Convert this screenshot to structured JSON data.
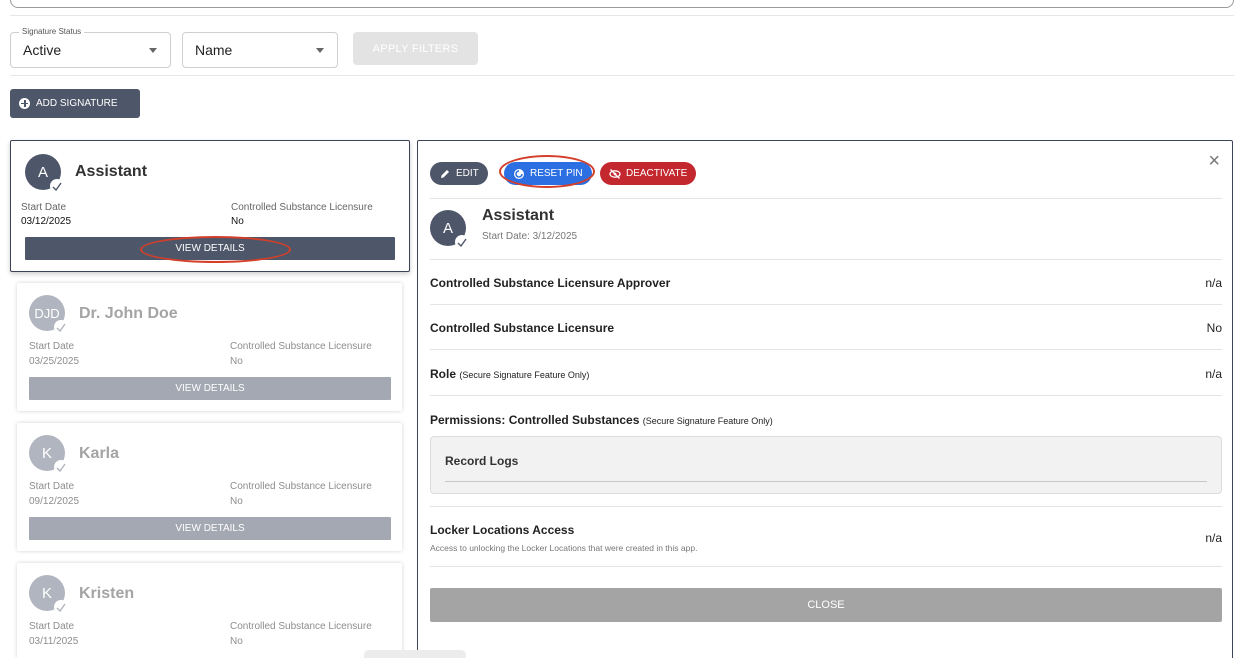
{
  "filters": {
    "status_legend": "Signature Status",
    "status_value": "Active",
    "sort_value": "Name",
    "apply_label": "APPLY FILTERS"
  },
  "add_signature_label": "ADD SIGNATURE",
  "cards": [
    {
      "initials": "A",
      "name": "Assistant",
      "start_label": "Start Date",
      "start_value": "03/12/2025",
      "csl_label": "Controlled Substance Licensure",
      "csl_value": "No",
      "view_label": "VIEW DETAILS"
    },
    {
      "initials": "DJD",
      "name": "Dr. John Doe",
      "start_label": "Start Date",
      "start_value": "03/25/2025",
      "csl_label": "Controlled Substance Licensure",
      "csl_value": "No",
      "view_label": "VIEW DETAILS"
    },
    {
      "initials": "K",
      "name": "Karla",
      "start_label": "Start Date",
      "start_value": "09/12/2025",
      "csl_label": "Controlled Substance Licensure",
      "csl_value": "No",
      "view_label": "VIEW DETAILS"
    },
    {
      "initials": "K",
      "name": "Kristen",
      "start_label": "Start Date",
      "start_value": "03/11/2025",
      "csl_label": "Controlled Substance Licensure",
      "csl_value": "No",
      "view_label": "VIEW DETAILS"
    }
  ],
  "detail": {
    "edit_label": "EDIT",
    "reset_pin_label": "RESET PIN",
    "deactivate_label": "DEACTIVATE",
    "close_x": "×",
    "initials": "A",
    "name": "Assistant",
    "start": "Start Date: 3/12/2025",
    "rows": [
      {
        "label": "Controlled Substance Licensure Approver",
        "note": "",
        "value": "n/a"
      },
      {
        "label": "Controlled Substance Licensure",
        "note": "",
        "value": "No"
      },
      {
        "label": "Role",
        "note": "(Secure Signature Feature Only)",
        "value": "n/a"
      }
    ],
    "permissions_label": "Permissions: Controlled Substances",
    "permissions_note": "(Secure Signature Feature Only)",
    "permissions_item": "Record Logs",
    "locker_label": "Locker Locations Access",
    "locker_sub": "Access to unlocking the Locker Locations that were created in this app.",
    "locker_value": "n/a",
    "close_label": "CLOSE"
  },
  "colors": {
    "primary": "#4e5669",
    "reset_blue": "#2c6fe2",
    "deactivate_red": "#c4282f",
    "highlight_oval": "#d33f2a"
  }
}
